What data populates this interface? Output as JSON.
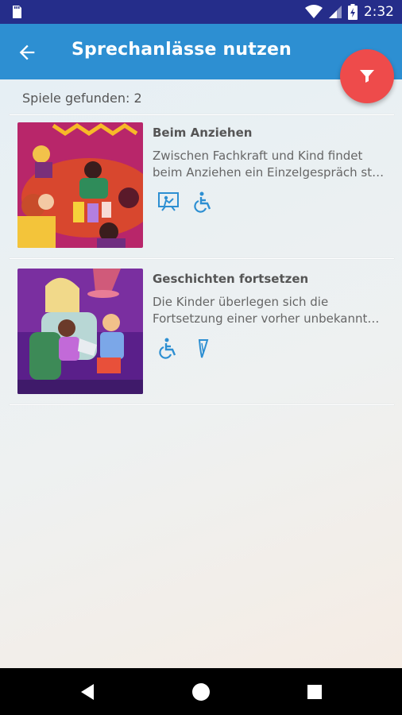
{
  "status_bar": {
    "time": "2:32",
    "icons": [
      "sd-card-icon",
      "wifi-icon",
      "signal-icon",
      "battery-icon"
    ]
  },
  "app_bar": {
    "title": "Sprechanlässe nutzen",
    "back_icon": "arrow-back-icon",
    "filter_icon": "filter-icon"
  },
  "results": {
    "count_label": "Spiele gefunden: 2"
  },
  "items": [
    {
      "title": "Beim Anziehen",
      "description_lines": [
        "Zwischen Fachkraft und Kind findet",
        "beim Anziehen ein Einzelgespräch st…"
      ],
      "icons": [
        "presentation-icon",
        "accessibility-icon"
      ]
    },
    {
      "title": "Geschichten fortsetzen",
      "description_lines": [
        "Die Kinder überlegen sich die",
        "Fortsetzung einer vorher unbekannt…"
      ],
      "icons": [
        "accessibility-icon",
        "pen-icon"
      ]
    }
  ],
  "nav_bar": {
    "icons": [
      "back-triangle-icon",
      "home-circle-icon",
      "recents-square-icon"
    ]
  },
  "colors": {
    "status_bar": "#252d8a",
    "app_bar": "#2d8fd2",
    "fab": "#ee4b4b",
    "icon_accent": "#2d8fd2"
  }
}
